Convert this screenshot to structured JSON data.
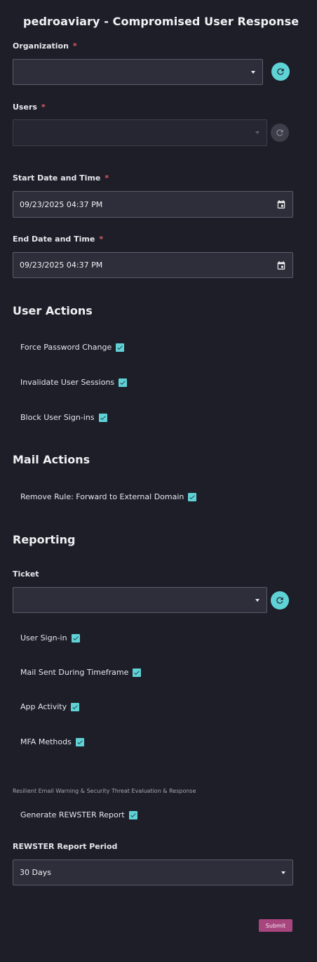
{
  "page_title": "pedroaviary - Compromised User Response",
  "required_mark": "*",
  "organization": {
    "label": "Organization",
    "value": ""
  },
  "users": {
    "label": "Users",
    "value": ""
  },
  "start": {
    "label": "Start Date and Time",
    "value": "09/23/2025 04:37 PM"
  },
  "end": {
    "label": "End Date and Time",
    "value": "09/23/2025 04:37 PM"
  },
  "user_actions": {
    "heading": "User Actions",
    "items": [
      {
        "label": "Force Password Change",
        "checked": true
      },
      {
        "label": "Invalidate User Sessions",
        "checked": true
      },
      {
        "label": "Block User Sign-ins",
        "checked": true
      }
    ]
  },
  "mail_actions": {
    "heading": "Mail Actions",
    "items": [
      {
        "label": "Remove Rule: Forward to External Domain",
        "checked": true
      }
    ]
  },
  "reporting": {
    "heading": "Reporting",
    "ticket_label": "Ticket",
    "ticket_value": "",
    "items": [
      {
        "label": "User Sign-in",
        "checked": true
      },
      {
        "label": "Mail Sent During Timeframe",
        "checked": true
      },
      {
        "label": "App Activity",
        "checked": true
      },
      {
        "label": "MFA Methods",
        "checked": true
      }
    ],
    "rewster_note": "Resilient Email Warning & Security Threat Evaluation & Response",
    "rewster_item": {
      "label": "Generate REWSTER Report",
      "checked": true
    },
    "period_label": "REWSTER Report Period",
    "period_value": "30 Days"
  },
  "submit_label": "Submit",
  "colors": {
    "background": "#1d1e28",
    "accent": "#5fd2d6",
    "submit": "#a8457f",
    "required": "#e05a63"
  }
}
